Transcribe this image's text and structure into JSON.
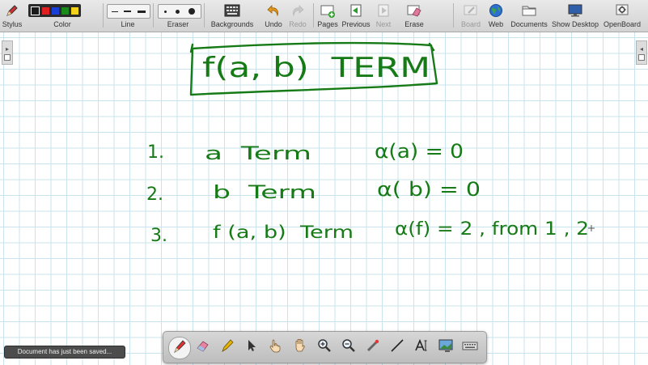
{
  "toolbar": {
    "stylus": "Stylus",
    "color": "Color",
    "line": "Line",
    "eraser": "Eraser",
    "backgrounds": "Backgrounds",
    "undo": "Undo",
    "redo": "Redo",
    "pages": "Pages",
    "previous": "Previous",
    "next": "Next",
    "erase": "Erase",
    "board": "Board",
    "web": "Web",
    "documents": "Documents",
    "show_desktop": "Show Desktop",
    "openboard": "OpenBoard"
  },
  "colors": {
    "ink": "#167a16",
    "palette": [
      "#1a1a1a",
      "#e02020",
      "#1a3fd6",
      "#1a8a1a",
      "#f2d21a"
    ]
  },
  "board": {
    "title_text": "f(a, b)  TERM",
    "lines": [
      {
        "num": "1.",
        "term": "a  Term",
        "formula": "α(a) = 0"
      },
      {
        "num": "2.",
        "term": "b  Term",
        "formula": "α( b) = 0"
      },
      {
        "num": "3.",
        "term": "f (a, b)  Term",
        "formula": "α(f) = 2 , from 1 , 2"
      }
    ]
  },
  "status": {
    "toast": "Document has just been saved..."
  },
  "icons": {
    "stylus": "stylus-icon",
    "backgrounds": "keyboard-grid-icon",
    "undo": "undo-arrow-icon",
    "redo": "redo-arrow-icon",
    "pages": "add-page-icon",
    "previous": "previous-page-icon",
    "next": "next-page-icon",
    "erase": "erase-board-icon",
    "board": "board-icon",
    "web": "globe-icon",
    "documents": "folder-icon",
    "show_desktop": "monitor-icon",
    "openboard": "gear-icon"
  }
}
